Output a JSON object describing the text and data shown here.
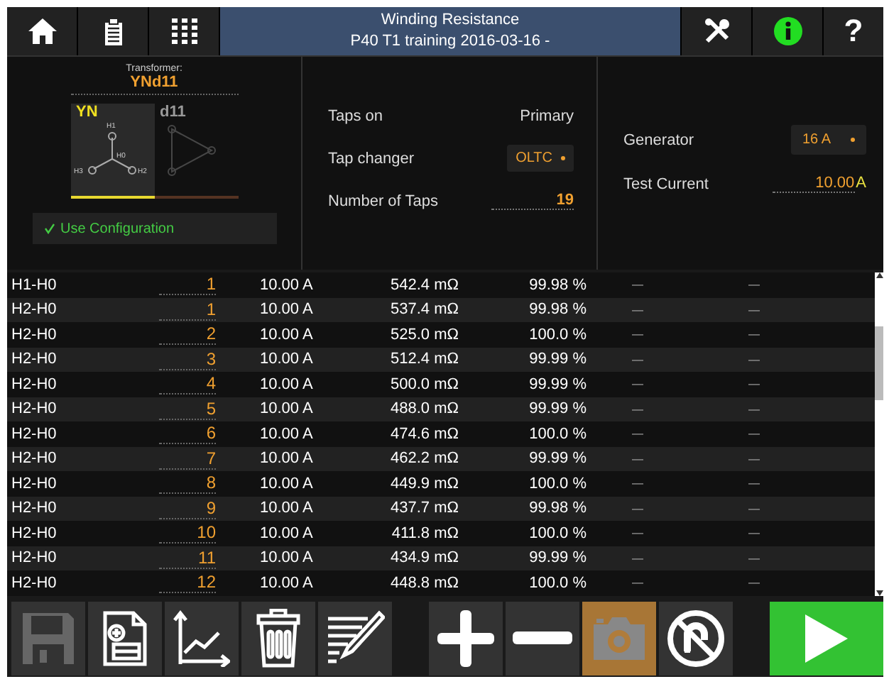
{
  "header": {
    "title": "Winding Resistance",
    "subtitle": "P40 T1 training 2016-03-16 -",
    "help_label": "?"
  },
  "transformer": {
    "label": "Transformer:",
    "value": "YNd11",
    "windings": [
      {
        "label": "YN",
        "selected": true
      },
      {
        "label": "d11",
        "selected": false
      }
    ],
    "terminals": [
      "H1",
      "H0",
      "H3",
      "H2"
    ],
    "use_configuration": {
      "label": "Use Configuration",
      "checked": true
    }
  },
  "taps": {
    "taps_on": {
      "label": "Taps on",
      "value": "Primary"
    },
    "tap_changer": {
      "label": "Tap changer",
      "value": "OLTC"
    },
    "number_of_taps": {
      "label": "Number of Taps",
      "value": "19"
    }
  },
  "generator": {
    "generator": {
      "label": "Generator",
      "value": "16 A"
    },
    "test_current": {
      "label": "Test Current",
      "value": "10.00",
      "unit": "A"
    }
  },
  "table": {
    "rows": [
      {
        "column_1": "H1-H0",
        "column_2": "1",
        "column_3": "10.00 A",
        "column_4": "542.4 mΩ",
        "column_5": "99.98 %",
        "column_6": "—",
        "column_7": "—"
      },
      {
        "column_1": "H2-H0",
        "column_2": "1",
        "column_3": "10.00 A",
        "column_4": "537.4 mΩ",
        "column_5": "99.98 %",
        "column_6": "—",
        "column_7": "—"
      },
      {
        "column_1": "H2-H0",
        "column_2": "2",
        "column_3": "10.00 A",
        "column_4": "525.0 mΩ",
        "column_5": "100.0 %",
        "column_6": "—",
        "column_7": "—"
      },
      {
        "column_1": "H2-H0",
        "column_2": "3",
        "column_3": "10.00 A",
        "column_4": "512.4 mΩ",
        "column_5": "99.99 %",
        "column_6": "—",
        "column_7": "—"
      },
      {
        "column_1": "H2-H0",
        "column_2": "4",
        "column_3": "10.00 A",
        "column_4": "500.0 mΩ",
        "column_5": "99.99 %",
        "column_6": "—",
        "column_7": "—"
      },
      {
        "column_1": "H2-H0",
        "column_2": "5",
        "column_3": "10.00 A",
        "column_4": "488.0 mΩ",
        "column_5": "99.99 %",
        "column_6": "—",
        "column_7": "—"
      },
      {
        "column_1": "H2-H0",
        "column_2": "6",
        "column_3": "10.00 A",
        "column_4": "474.6 mΩ",
        "column_5": "100.0 %",
        "column_6": "—",
        "column_7": "—"
      },
      {
        "column_1": "H2-H0",
        "column_2": "7",
        "column_3": "10.00 A",
        "column_4": "462.2 mΩ",
        "column_5": "99.99 %",
        "column_6": "—",
        "column_7": "—"
      },
      {
        "column_1": "H2-H0",
        "column_2": "8",
        "column_3": "10.00 A",
        "column_4": "449.9 mΩ",
        "column_5": "100.0 %",
        "column_6": "—",
        "column_7": "—"
      },
      {
        "column_1": "H2-H0",
        "column_2": "9",
        "column_3": "10.00 A",
        "column_4": "437.7 mΩ",
        "column_5": "99.98 %",
        "column_6": "—",
        "column_7": "—"
      },
      {
        "column_1": "H2-H0",
        "column_2": "10",
        "column_3": "10.00 A",
        "column_4": "411.8 mΩ",
        "column_5": "100.0 %",
        "column_6": "—",
        "column_7": "—"
      },
      {
        "column_1": "H2-H0",
        "column_2": "11",
        "column_3": "10.00 A",
        "column_4": "434.9 mΩ",
        "column_5": "99.99 %",
        "column_6": "—",
        "column_7": "—"
      },
      {
        "column_1": "H2-H0",
        "column_2": "12",
        "column_3": "10.00 A",
        "column_4": "448.8 mΩ",
        "column_5": "100.0 %",
        "column_6": "—",
        "column_7": "—"
      }
    ]
  },
  "toolbar": [
    {
      "kind": "save",
      "disabled": true,
      "selected": false
    },
    {
      "kind": "new_report",
      "disabled": false,
      "selected": false
    },
    {
      "kind": "chart",
      "disabled": false,
      "selected": false
    },
    {
      "kind": "delete",
      "disabled": false,
      "selected": false
    },
    {
      "kind": "edit",
      "disabled": false,
      "selected": false
    },
    {
      "kind": "add",
      "disabled": false,
      "selected": false
    },
    {
      "kind": "remove",
      "disabled": false,
      "selected": false
    },
    {
      "kind": "camera",
      "disabled": false,
      "selected": true
    },
    {
      "kind": "no_magnet",
      "disabled": false,
      "selected": false
    },
    {
      "kind": "start",
      "disabled": false,
      "selected": false
    }
  ]
}
